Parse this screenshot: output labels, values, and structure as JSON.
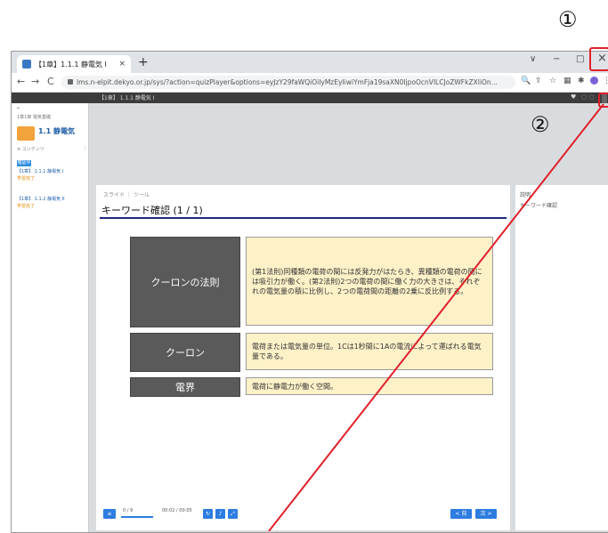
{
  "annotations": {
    "circle1": "①",
    "circle2": "②"
  },
  "browser": {
    "tab_title": "【1章】1.1.1 静電気 I",
    "new_tab": "+",
    "window": {
      "chevron": "∨",
      "minimize": "−",
      "maximize": "□",
      "close": "×"
    },
    "url": "lms.n-elpit.dekyo.or.jp/sys/?action=quizPlayer&options=eyJzY29faWQiOiIyMzEyIiwiYmFja19saXN0IjpoOcnVlLCJoZWFkZXIiOn...",
    "back": "←",
    "forward": "→",
    "reload": "C"
  },
  "app_header": {
    "title": "【1章】 1.1.1 静電気 I"
  },
  "sidebar": {
    "breadcrumb": "1章1節 電気基礎",
    "course_title": "1.1 静電気",
    "contents_label": "≡ コンテンツ",
    "badge": "確認中",
    "items": [
      {
        "label": "【1章】 1.1.1 静電気 I",
        "status": "学習完了"
      },
      {
        "label": "【1章】 1.1.2 静電気 II",
        "status": "学習完了"
      }
    ]
  },
  "slide": {
    "crumb": "スライド ｜ ツール",
    "heading": "キーワード確認 (1 / 1)",
    "rows": [
      {
        "term": "クーロンの法則",
        "desc": "(第1法則)同種類の電荷の間には反発力がはたらき、異種類の電荷の間には吸引力が働く。(第2法則)2つの電荷の間に働く力の大きさは、それぞれの電気量の積に比例し、2つの電荷間の距離の2乗に反比例する。"
      },
      {
        "term": "クーロン",
        "desc": "電荷または電気量の単位。1Cは1秒間に1Aの電流によって運ばれる電気量である。"
      },
      {
        "term": "電界",
        "desc": "電荷に静電力が働く空間。"
      }
    ]
  },
  "right_panel": {
    "header": "説明",
    "item": "キーワード確認"
  },
  "player": {
    "counter": "0 / 9",
    "time": "00:02 / 00:05",
    "prev": "< 前",
    "next": "次 >"
  },
  "colors": {
    "highlight": "#e0202a",
    "accent": "#2d7de0",
    "heading_rule": "#1e2a78"
  }
}
